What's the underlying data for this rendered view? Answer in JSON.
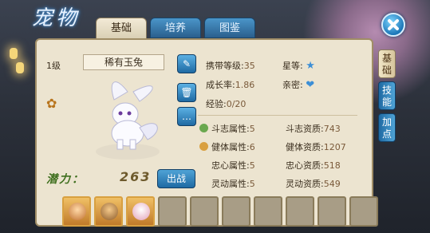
{
  "window": {
    "title": "宠物"
  },
  "tabs": [
    {
      "label": "基础",
      "active": true
    },
    {
      "label": "培养",
      "active": false
    },
    {
      "label": "图鉴",
      "active": false
    }
  ],
  "side_tabs": [
    {
      "label": "基础",
      "active": true
    },
    {
      "label": "技能",
      "active": false
    },
    {
      "label": "加点",
      "active": false
    }
  ],
  "pet": {
    "level": "1级",
    "name": "稀有玉兔",
    "potential_label": "潜力：",
    "potential_value": "263",
    "fight_button": "出战"
  },
  "info": {
    "carry_level": {
      "label": "携带等级:",
      "value": "35"
    },
    "star": {
      "label": "星等:"
    },
    "growth": {
      "label": "成长率:",
      "value": "1.86"
    },
    "intimacy": {
      "label": "亲密:"
    },
    "exp": {
      "label": "经验:",
      "value": "0/20"
    }
  },
  "attributes": [
    {
      "label": "斗志属性:",
      "value": "5",
      "apt_label": "斗志资质:",
      "apt_value": "743"
    },
    {
      "label": "健体属性:",
      "value": "6",
      "apt_label": "健体资质:",
      "apt_value": "1207"
    },
    {
      "label": "忠心属性:",
      "value": "5",
      "apt_label": "忠心资质:",
      "apt_value": "518"
    },
    {
      "label": "灵动属性:",
      "value": "5",
      "apt_label": "灵动资质:",
      "apt_value": "549"
    }
  ],
  "icons": [
    "brush-icon",
    "trash-icon",
    "chat-icon",
    "star-icon",
    "heart-icon",
    "close-icon"
  ],
  "colors": {
    "accent": "#2a6fa8",
    "panel": "#ece4d0",
    "potential": "#3f6f1e"
  }
}
